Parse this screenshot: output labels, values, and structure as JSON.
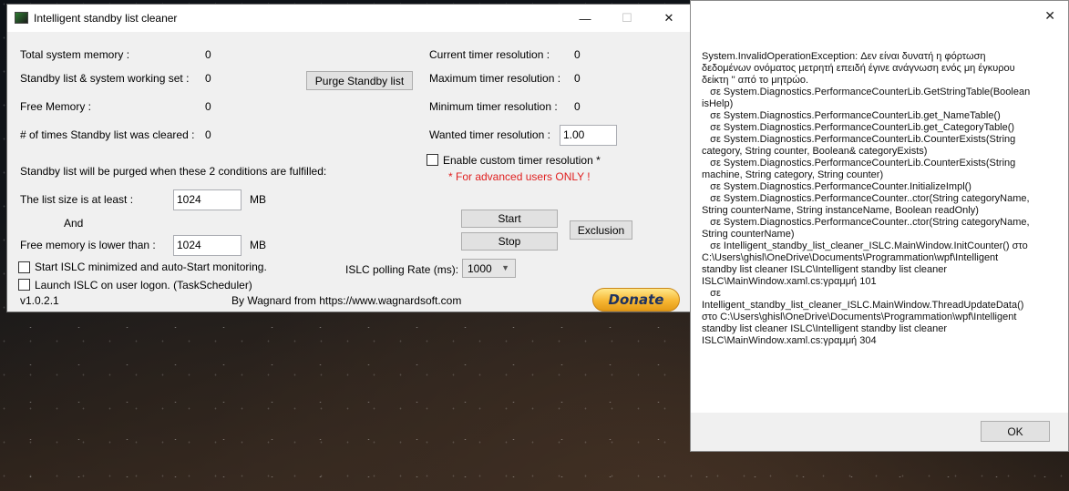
{
  "main_window": {
    "title": "Intelligent standby list cleaner",
    "caption": {
      "minimize": "—",
      "maximize": "☐",
      "close": "✕"
    },
    "stats": {
      "total_memory_label": "Total system memory :",
      "total_memory_value": "0",
      "standby_label": "Standby list & system working set :",
      "standby_value": "0",
      "free_memory_label": "Free Memory :",
      "free_memory_value": "0",
      "cleared_label": "# of times Standby list was cleared :",
      "cleared_value": "0"
    },
    "purge_button": "Purge Standby list",
    "timer": {
      "current_label": "Current timer resolution :",
      "current_value": "0",
      "maximum_label": "Maximum timer resolution :",
      "maximum_value": "0",
      "minimum_label": "Minimum timer resolution :",
      "minimum_value": "0",
      "wanted_label": "Wanted timer resolution :",
      "wanted_value": "1.00",
      "custom_label": "Enable custom timer resolution *",
      "custom_checked": false,
      "advanced_warning": "* For advanced users ONLY !"
    },
    "conditions_heading": "Standby list will be purged when these 2 conditions are fulfilled:",
    "list_size_label": "The list size is at least :",
    "list_size_value": "1024",
    "list_size_unit": "MB",
    "and_label": "And",
    "free_mem_label": "Free memory is lower than :",
    "free_mem_value": "1024",
    "free_mem_unit": "MB",
    "start_button": "Start",
    "stop_button": "Stop",
    "exclusion_button": "Exclusion",
    "minimized_label": "Start ISLC minimized and auto-Start monitoring.",
    "minimized_checked": false,
    "logon_label": "Launch ISLC on user logon. (TaskScheduler)",
    "logon_checked": false,
    "polling_label": "ISLC polling Rate (ms):",
    "polling_value": "1000",
    "version": "v1.0.2.1",
    "credit": "By Wagnard from https://www.wagnardsoft.com",
    "donate_label": "Donate",
    "accent_color": "#f7b733"
  },
  "error_dialog": {
    "close": "✕",
    "message": "System.InvalidOperationException: Δεν είναι δυνατή η φόρτωση δεδομένων ονόματος μετρητή επειδή έγινε ανάγνωση ενός μη έγκυρου δείκτη '' από το μητρώο.\n   σε System.Diagnostics.PerformanceCounterLib.GetStringTable(Boolean isHelp)\n   σε System.Diagnostics.PerformanceCounterLib.get_NameTable()\n   σε System.Diagnostics.PerformanceCounterLib.get_CategoryTable()\n   σε System.Diagnostics.PerformanceCounterLib.CounterExists(String category, String counter, Boolean& categoryExists)\n   σε System.Diagnostics.PerformanceCounterLib.CounterExists(String machine, String category, String counter)\n   σε System.Diagnostics.PerformanceCounter.InitializeImpl()\n   σε System.Diagnostics.PerformanceCounter..ctor(String categoryName, String counterName, String instanceName, Boolean readOnly)\n   σε System.Diagnostics.PerformanceCounter..ctor(String categoryName, String counterName)\n   σε Intelligent_standby_list_cleaner_ISLC.MainWindow.InitCounter() στο C:\\Users\\ghisl\\OneDrive\\Documents\\Programmation\\wpf\\Intelligent standby list cleaner ISLC\\Intelligent standby list cleaner ISLC\\MainWindow.xaml.cs:γραμμή 101\n   σε Intelligent_standby_list_cleaner_ISLC.MainWindow.ThreadUpdateData() στο C:\\Users\\ghisl\\OneDrive\\Documents\\Programmation\\wpf\\Intelligent standby list cleaner ISLC\\Intelligent standby list cleaner ISLC\\MainWindow.xaml.cs:γραμμή 304",
    "ok_button": "OK"
  }
}
